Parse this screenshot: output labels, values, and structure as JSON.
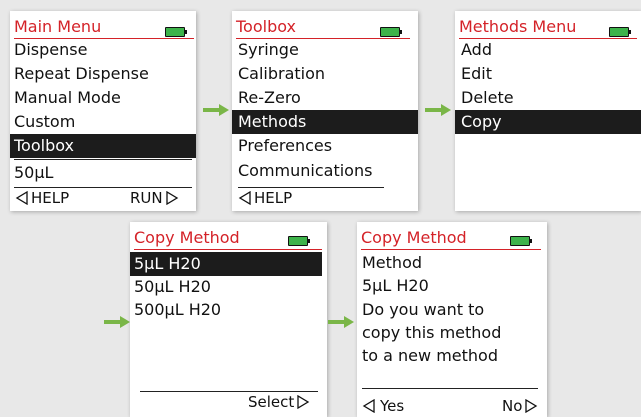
{
  "colors": {
    "title": "#d42228",
    "battery": "#3db34a",
    "arrow": "#7ab648",
    "selection": "#1c1c1c"
  },
  "main_menu": {
    "title": "Main Menu",
    "items": [
      "Dispense",
      "Repeat Dispense",
      "Manual Mode",
      "Custom",
      "Toolbox"
    ],
    "selected": "Toolbox",
    "volume": "50µL",
    "left_soft": "HELP",
    "right_soft": "RUN"
  },
  "toolbox": {
    "title": "Toolbox",
    "items": [
      "Syringe",
      "Calibration",
      "Re-Zero",
      "Methods",
      "Preferences",
      "Communications"
    ],
    "selected": "Methods",
    "left_soft": "HELP"
  },
  "methods_menu": {
    "title": "Methods Menu",
    "items": [
      "Add",
      "Edit",
      "Delete",
      "Copy"
    ],
    "selected": "Copy"
  },
  "copy_method_list": {
    "title": "Copy Method",
    "items": [
      "5µL H20",
      "50µL H20",
      "500µL H20"
    ],
    "selected": "5µL H20",
    "right_soft": "Select"
  },
  "copy_method_confirm": {
    "title": "Copy Method",
    "lines": [
      "Method",
      "5µL H20",
      "Do you want to",
      "copy this method",
      "to a new method"
    ],
    "left_soft": "Yes",
    "right_soft": "No"
  }
}
